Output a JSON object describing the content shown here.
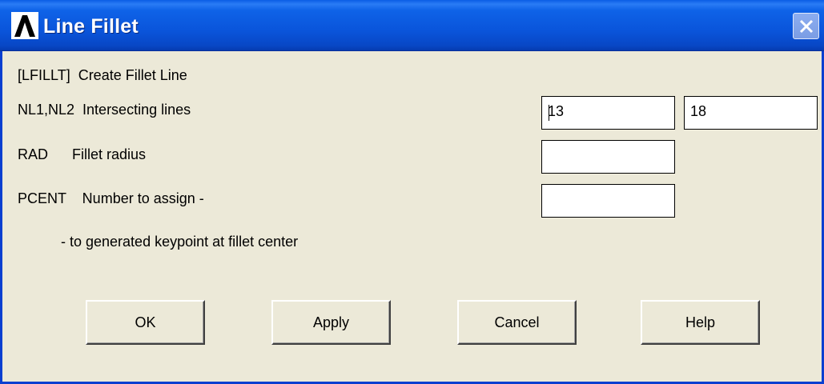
{
  "window": {
    "title": "Line Fillet",
    "app_icon": "ansys-logo-icon",
    "close_icon": "close-icon"
  },
  "form": {
    "header": "[LFILLT]  Create Fillet Line",
    "nl_label": "NL1,NL2  Intersecting lines",
    "nl1_value": "13",
    "nl2_value": "18",
    "rad_label": "RAD      Fillet radius",
    "rad_value": "",
    "pcent_label": "PCENT    Number to assign -",
    "pcent_value": "",
    "note": "- to generated keypoint at fillet center"
  },
  "buttons": {
    "ok": "OK",
    "apply": "Apply",
    "cancel": "Cancel",
    "help": "Help"
  },
  "colors": {
    "titlebar": "#0a55db",
    "dialog_bg": "#ece9d8",
    "border": "#0a3fd0"
  }
}
